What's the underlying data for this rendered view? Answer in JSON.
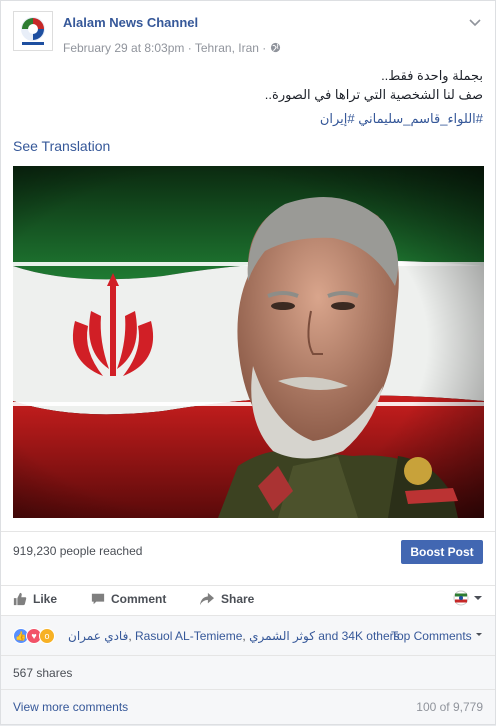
{
  "post": {
    "page_name": "Alalam News Channel",
    "date": "February 29 at 8:03pm",
    "separator": "·",
    "location": "Tehran, Iran",
    "separator2": "·",
    "text_line1": "بجملة واحدة فقط..",
    "text_line2": "صف لنا الشخصية التي تراها في الصورة..",
    "hashtags": "#اللواء_قاسم_سليماني #إيران",
    "see_translation": "See Translation"
  },
  "stats": {
    "reached": "919,230 people reached",
    "boost_label": "Boost Post"
  },
  "actions": {
    "like": "Like",
    "comment": "Comment",
    "share": "Share"
  },
  "reactions": {
    "reactor1": "فادي عمران",
    "sep1": ", ",
    "reactor2": "Rasuol AL-Temieme",
    "sep2": ", ",
    "reactor3": "كوثر الشمري",
    "others": " and 34K others",
    "top_comments": "Top Comments"
  },
  "shares": "567 shares",
  "comments": {
    "view_more": "View more comments",
    "counter": "100 of 9,779"
  },
  "colors": {
    "link": "#365899",
    "boost": "#4267b2",
    "like_blue": "#5890ff",
    "love_red": "#f25268",
    "wow_yellow": "#f7b125"
  },
  "icons": [
    "chevron-down-icon",
    "globe-icon",
    "like-icon",
    "comment-icon",
    "share-icon",
    "flag-avatar-icon"
  ]
}
